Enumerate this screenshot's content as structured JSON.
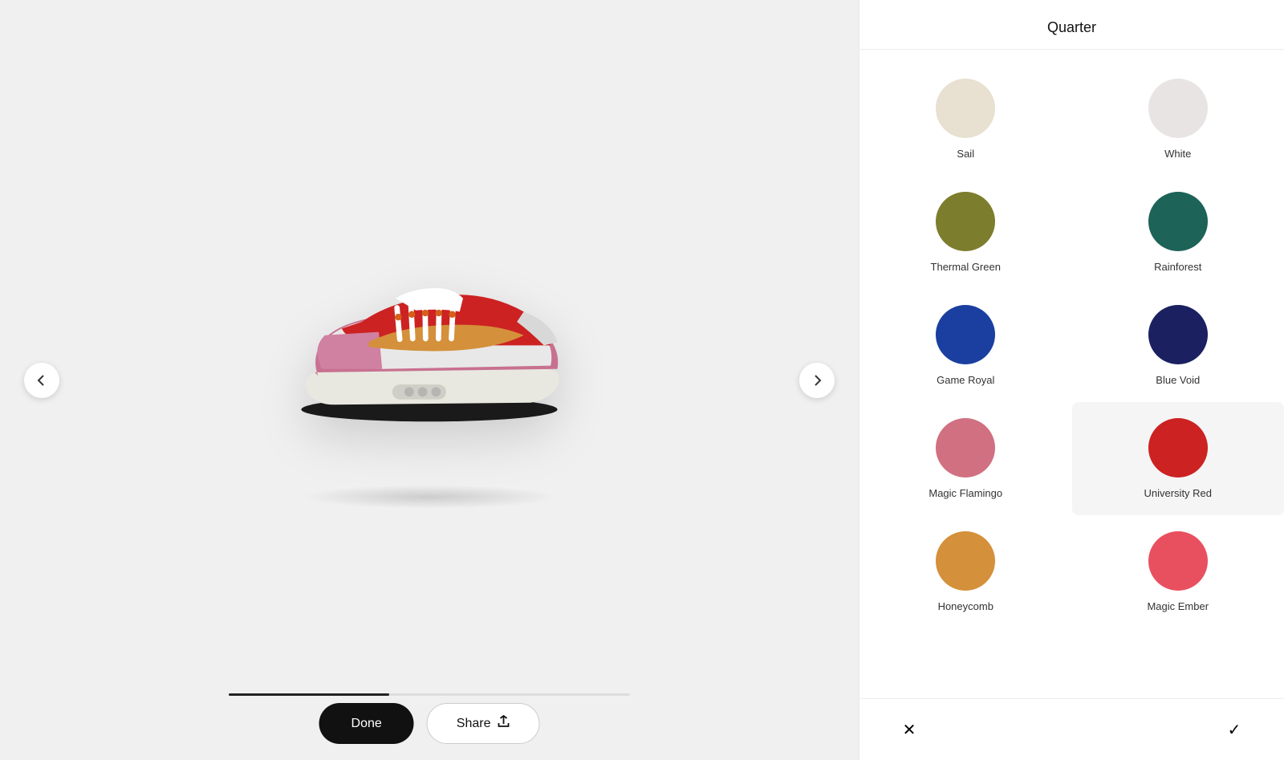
{
  "header": {
    "title": "Quarter"
  },
  "nav": {
    "left_icon": "‹",
    "right_icon": "›"
  },
  "buttons": {
    "done_label": "Done",
    "share_label": "Share",
    "share_icon": "↑",
    "cancel_icon": "✕",
    "confirm_icon": "✓"
  },
  "colors": [
    {
      "id": "sail",
      "label": "Sail",
      "hex": "#e8e0d0",
      "selected": false
    },
    {
      "id": "white",
      "label": "White",
      "hex": "#e8e4e4",
      "selected": false
    },
    {
      "id": "thermal-green",
      "label": "Thermal Green",
      "hex": "#7d7d2e",
      "selected": false
    },
    {
      "id": "rainforest",
      "label": "Rainforest",
      "hex": "#1d6357",
      "selected": false
    },
    {
      "id": "game-royal",
      "label": "Game Royal",
      "hex": "#1a3fa0",
      "selected": false
    },
    {
      "id": "blue-void",
      "label": "Blue Void",
      "hex": "#1a2060",
      "selected": false
    },
    {
      "id": "magic-flamingo",
      "label": "Magic Flamingo",
      "hex": "#d07080",
      "selected": false
    },
    {
      "id": "university-red",
      "label": "University Red",
      "hex": "#cc2222",
      "selected": true
    },
    {
      "id": "honeycomb",
      "label": "Honeycomb",
      "hex": "#d4903a",
      "selected": false
    },
    {
      "id": "magic-ember",
      "label": "Magic Ember",
      "hex": "#e85060",
      "selected": false
    }
  ],
  "progress": {
    "fill_percent": 40
  }
}
